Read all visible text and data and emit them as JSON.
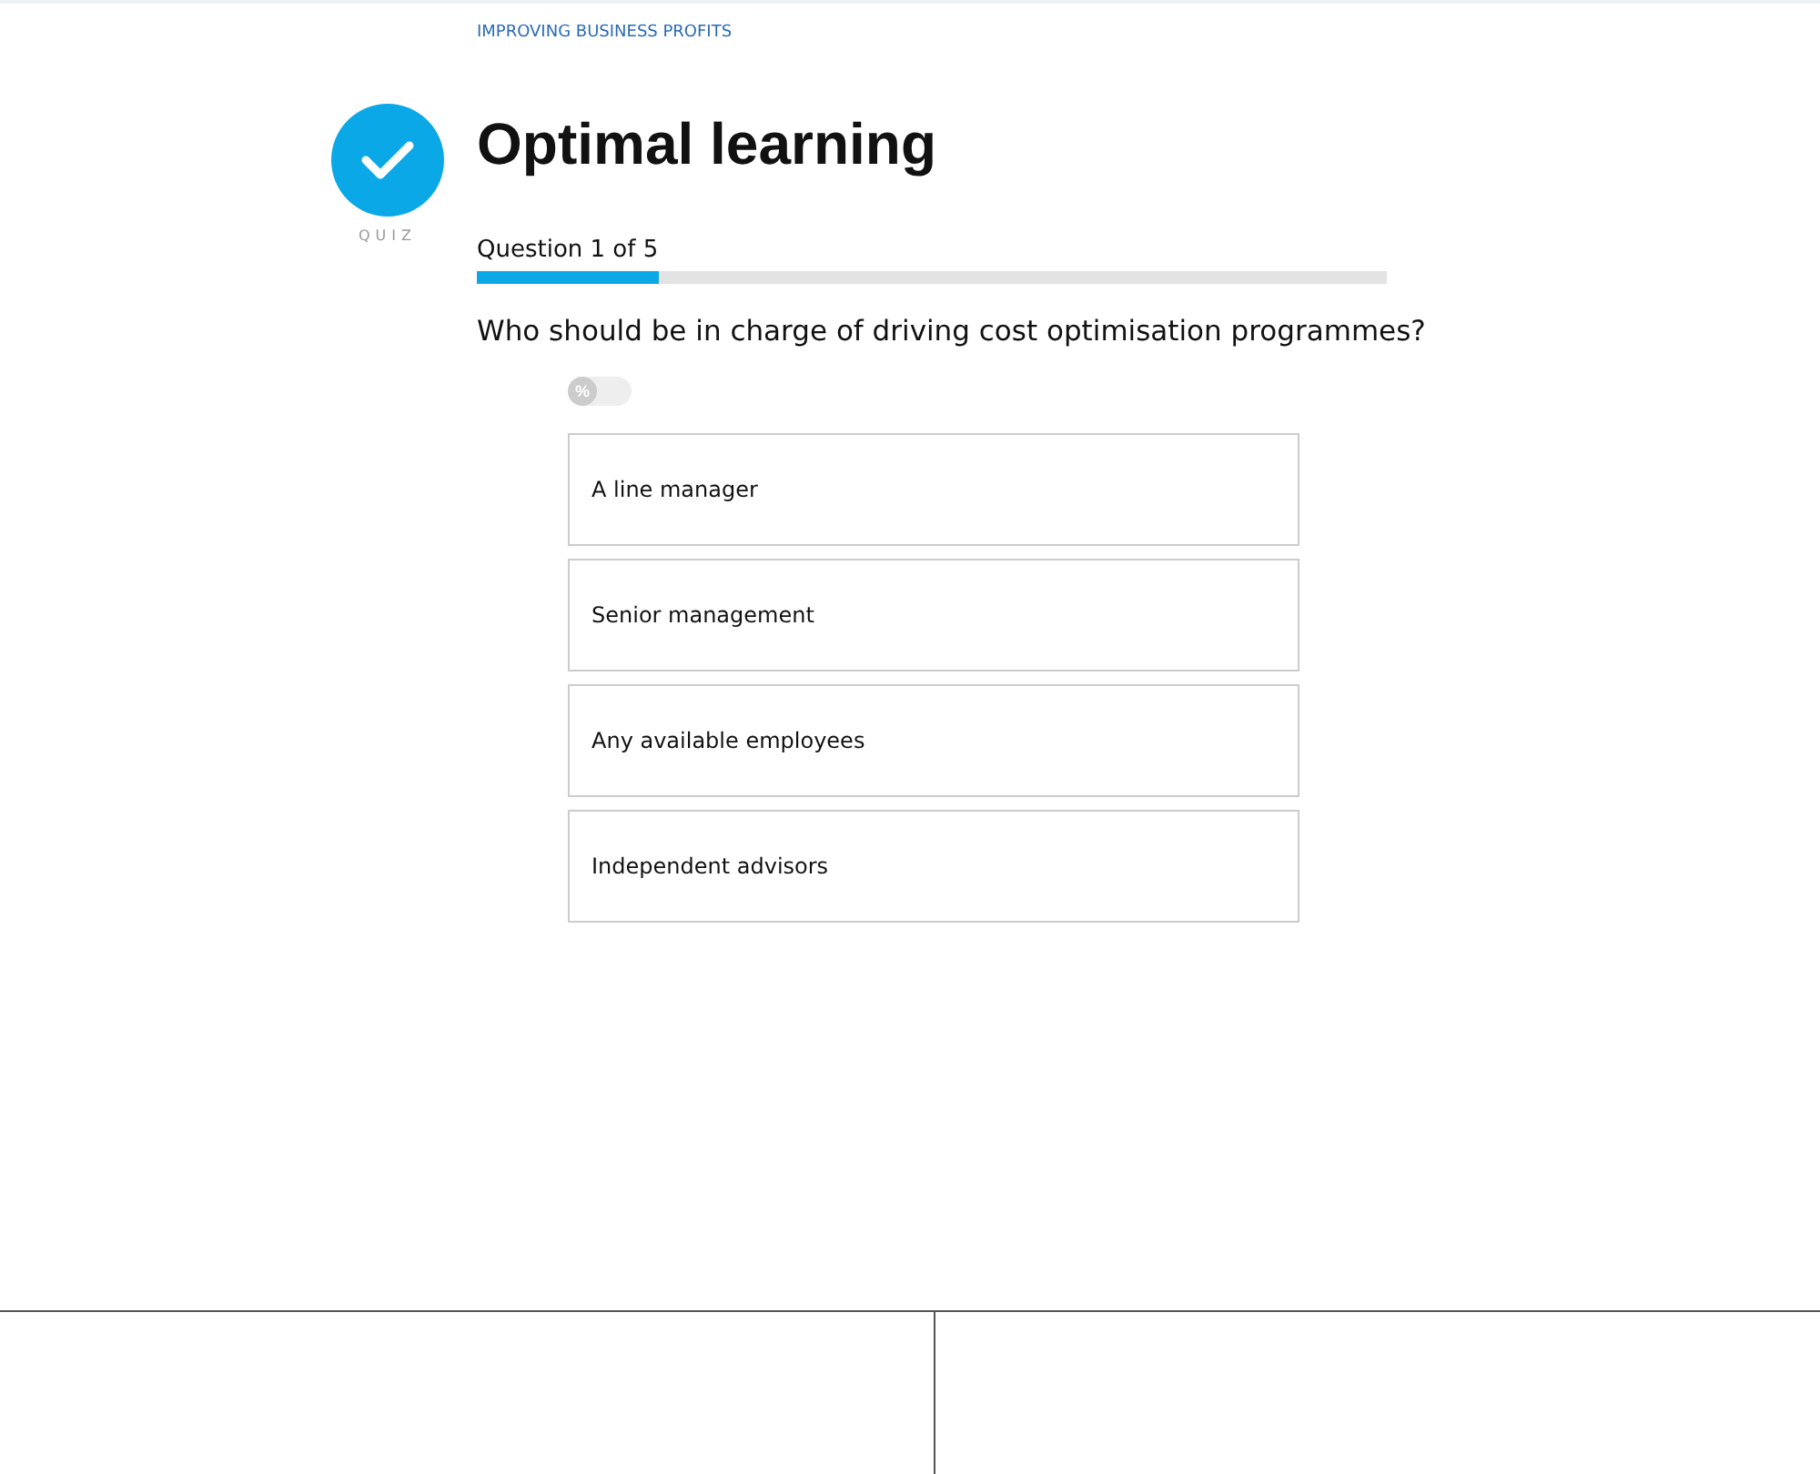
{
  "breadcrumb": "IMPROVING BUSINESS PROFITS",
  "badge": {
    "label": "QUIZ"
  },
  "title": "Optimal learning",
  "progress": {
    "label": "Question 1 of 5",
    "level": 0.2
  },
  "question": "Who should be in charge of driving cost optimisation programmes?",
  "toggle": {
    "label": "%",
    "on": false
  },
  "answers": [
    {
      "label": "A line manager",
      "selected": false
    },
    {
      "label": "Senior management",
      "selected": false
    },
    {
      "label": "Any available employees",
      "selected": false
    },
    {
      "label": "Independent advisors",
      "selected": false
    }
  ]
}
